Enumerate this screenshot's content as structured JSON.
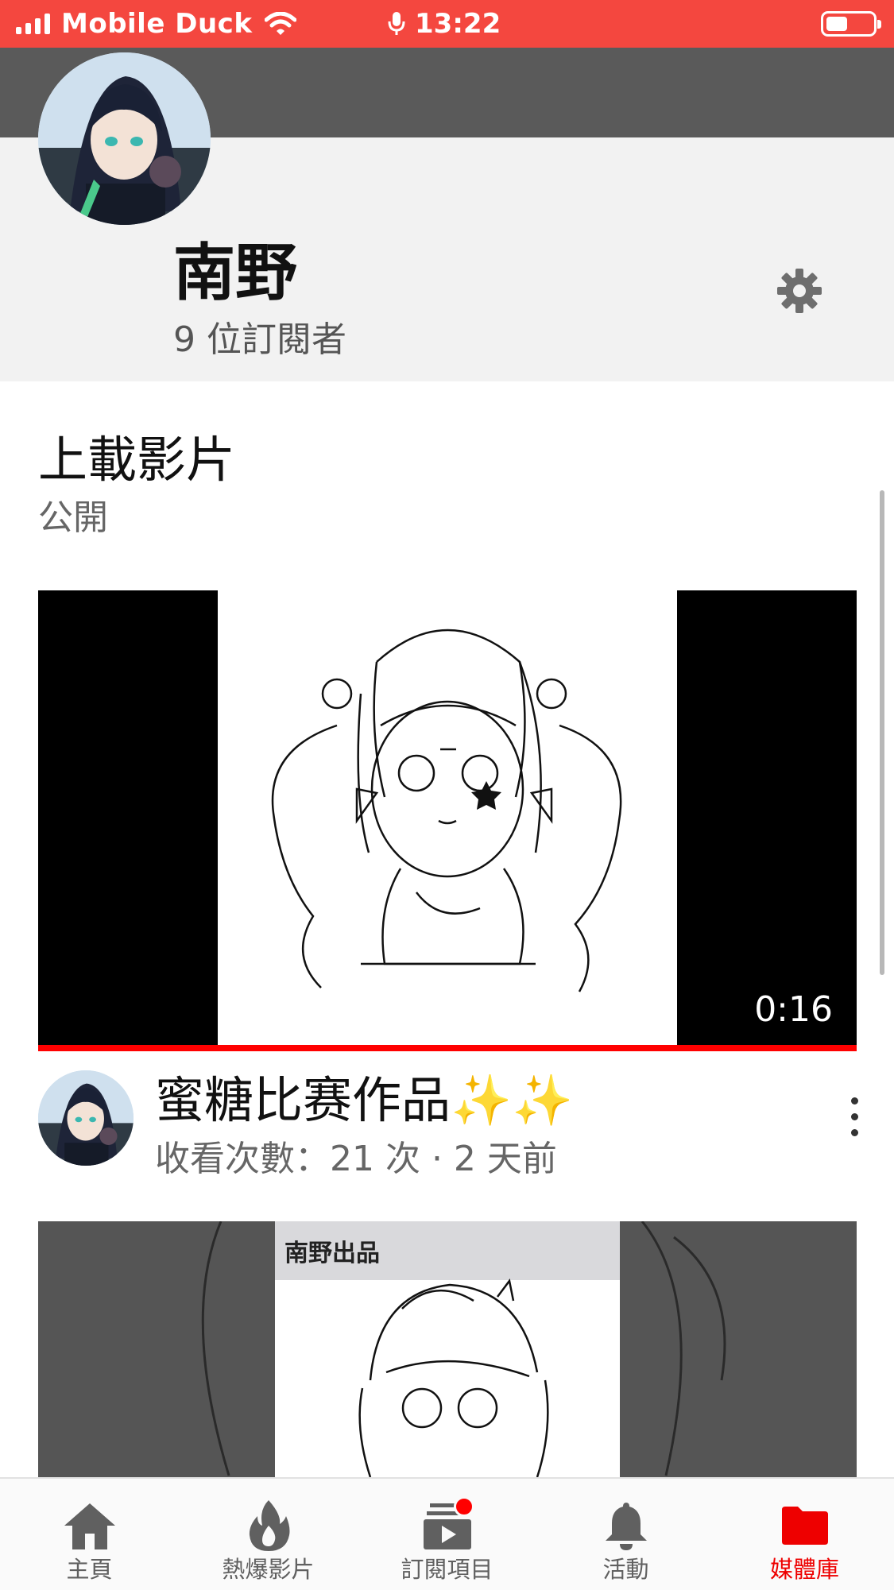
{
  "status_bar": {
    "carrier": "Mobile Duck",
    "time": "13:22",
    "color": "#f4473f"
  },
  "channel": {
    "name": "南野",
    "subscribers": "9 位訂閱者",
    "banner_color": "#5a5a5a"
  },
  "section": {
    "title": "上載影片",
    "subtitle": "公開"
  },
  "videos": [
    {
      "duration": "0:16",
      "watched_fraction": 1.0,
      "title": "蜜糖比赛作品",
      "title_emoji": "✨✨",
      "stats": "收看次數：21 次 · 2 天前"
    },
    {
      "thumbnail_text": "南野出品"
    }
  ],
  "bottom_nav": {
    "items": [
      {
        "label": "主頁",
        "icon": "home-icon"
      },
      {
        "label": "熱爆影片",
        "icon": "flame-icon"
      },
      {
        "label": "訂閱項目",
        "icon": "subscriptions-icon"
      },
      {
        "label": "活動",
        "icon": "bell-icon"
      },
      {
        "label": "媒體庫",
        "icon": "folder-icon"
      }
    ],
    "active_color": "#ee0000"
  }
}
